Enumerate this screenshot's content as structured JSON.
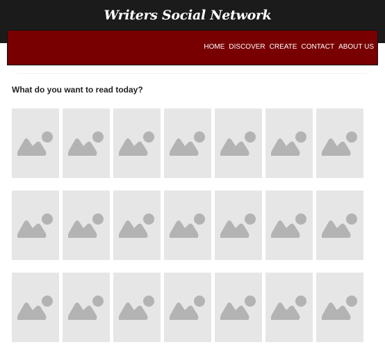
{
  "header": {
    "site_title": "Writers Social Network"
  },
  "nav": {
    "items": [
      "HOME",
      "DISCOVER",
      "CREATE",
      "CONTACT",
      "ABOUT US"
    ]
  },
  "main": {
    "heading": "What do you want to read today?",
    "book_rows": 3,
    "books_per_row": 7,
    "placeholder_icon": "image-placeholder-icon"
  },
  "colors": {
    "header_bg": "#1b1b1b",
    "nav_bg": "#780000",
    "placeholder_bg": "#e6e6e6",
    "placeholder_icon": "#b3b3b3"
  }
}
